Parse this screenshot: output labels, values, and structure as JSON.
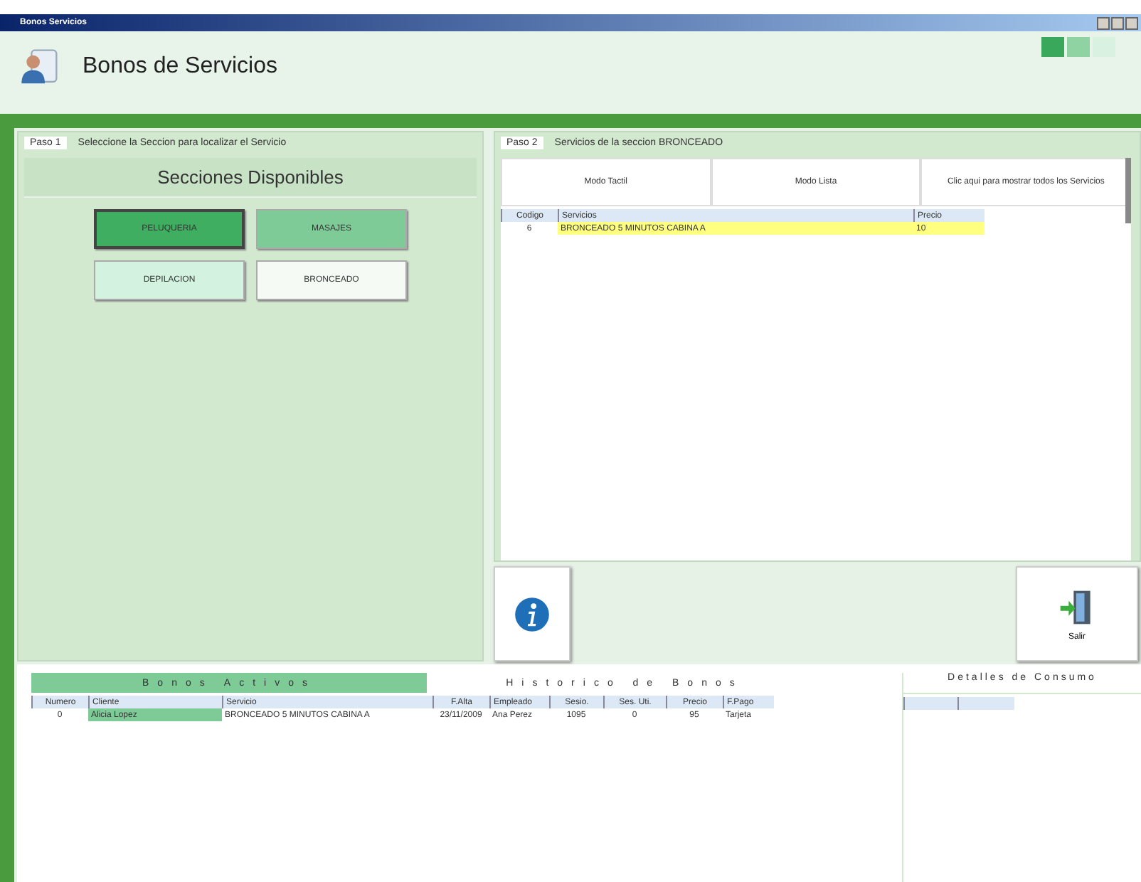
{
  "window": {
    "title": "Bonos Servicios"
  },
  "header": {
    "title": "Bonos de Servicios"
  },
  "step1": {
    "label": "Paso 1",
    "text": "Seleccione la Seccion para localizar el Servicio",
    "heading": "Secciones Disponibles",
    "sections": [
      {
        "label": "PELUQUERIA",
        "color": "#3fae60",
        "selected": true
      },
      {
        "label": "MASAJES",
        "color": "#7fcb98",
        "selected": false
      },
      {
        "label": "DEPILACION",
        "color": "#d3f2e0",
        "selected": false
      },
      {
        "label": "BRONCEADO",
        "color": "#f5faf5",
        "selected": false
      }
    ]
  },
  "step2": {
    "label": "Paso 2",
    "text": "Servicios de la seccion BRONCEADO",
    "modes": [
      "Modo Tactil",
      "Modo Lista",
      "Clic aqui para mostrar todos los Servicios"
    ],
    "table": {
      "columns": [
        "Codigo",
        "Servicios",
        "Precio"
      ],
      "rows": [
        {
          "cells": [
            "6",
            "BRONCEADO 5 MINUTOS CABINA A",
            "10"
          ],
          "selected": true
        }
      ]
    }
  },
  "exit_button": {
    "label": "Salir"
  },
  "bottom": {
    "tabs": [
      {
        "label": "Bonos Activos",
        "selected": true
      },
      {
        "label": "Historico de Bonos",
        "selected": false
      }
    ],
    "table": {
      "columns": [
        "Numero",
        "Cliente",
        "Servicio",
        "F.Alta",
        "Empleado",
        "Sesio.",
        "Ses. Uti.",
        "Precio",
        "F.Pago"
      ],
      "rows": [
        {
          "cells": [
            "0",
            "Alicia Lopez",
            "BRONCEADO 5 MINUTOS CABINA A",
            "23/11/2009",
            "Ana Perez",
            "1095",
            "0",
            "95",
            "Tarjeta"
          ]
        }
      ]
    },
    "details": {
      "title": "Detalles de Consumo"
    }
  }
}
